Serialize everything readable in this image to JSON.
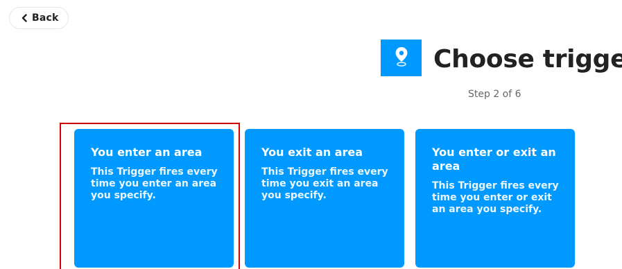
{
  "header": {
    "back_label": "Back",
    "title": "Choose trigger",
    "step_text": "Step 2 of 6",
    "service_icon": "location-pin-icon",
    "accent_color": "#0099ff"
  },
  "triggers": [
    {
      "title": "You enter an area",
      "description": "This Trigger fires every time you enter an area you specify.",
      "selected": true
    },
    {
      "title": "You exit an area",
      "description": "This Trigger fires every time you exit an area you specify.",
      "selected": false
    },
    {
      "title": "You enter or exit an area",
      "description": "This Trigger fires every time you enter or exit an area you specify.",
      "selected": false
    }
  ],
  "colors": {
    "card_bg": "#0099ff",
    "selection_border": "#d40000",
    "title_text": "#222222",
    "muted_text": "#666666"
  }
}
